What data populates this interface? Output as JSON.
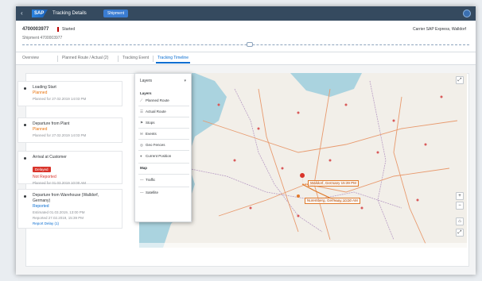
{
  "shell": {
    "back_icon": "back-arrow-icon",
    "logo_text": "SAP",
    "app_title": "Tracking Details",
    "system_badge": "Shipment"
  },
  "header": {
    "object_title": "4700003977",
    "status": "Started",
    "subtitle": "Shipment 4700003977",
    "right_info": "Carrier SAP Express, Walldorf"
  },
  "tabs": [
    {
      "label": "Overview"
    },
    {
      "label": "Planned Route / Actual (2)"
    },
    {
      "label": "Tracking Event"
    },
    {
      "label": "Tracking Timeline"
    }
  ],
  "timeline": [
    {
      "title": "Loading Start",
      "state": "Planned",
      "state_color": "#e9730c",
      "meta": "Planned for 27.02.2019 14:03 PM"
    },
    {
      "title": "Departure from Plant",
      "state": "Planned",
      "state_color": "#e9730c",
      "meta": "Planned for 27.02.2019 14:03 PM"
    },
    {
      "title": "Arrival at Customer",
      "badge": "Delayed",
      "state": "Not Reported",
      "state_color": "#d9342b",
      "meta": "Planned for 01.03.2019 10:00 AM"
    },
    {
      "title": "Departure from Warehouse (Walldorf, Germany)",
      "state": "Reported",
      "state_color": "#0a6ed1",
      "meta": "Estimated 01.03.2019, 13:00 PM",
      "meta2": "Reported 27.02.2019, 15:39 PM",
      "link": "Report Delay (1)"
    }
  ],
  "menu": {
    "header": "Layers",
    "section1": "Layers",
    "items1": [
      {
        "icon": "route-icon",
        "glyph": "⟋",
        "label": "Planned Route"
      },
      {
        "icon": "actual-route-icon",
        "glyph": "☰",
        "label": "Actual Route"
      },
      {
        "icon": "stops-icon",
        "glyph": "⚑",
        "label": "Stops"
      },
      {
        "icon": "events-icon",
        "glyph": "✉",
        "label": "Events"
      },
      {
        "icon": "geofence-icon",
        "glyph": "◎",
        "label": "Geo Fences"
      },
      {
        "icon": "vehicle-icon",
        "glyph": "●",
        "label": "Current Position"
      }
    ],
    "section2": "Map",
    "items2": [
      {
        "icon": "traffic-icon",
        "glyph": "―",
        "label": "Traffic"
      },
      {
        "icon": "satellite-icon",
        "glyph": "―",
        "label": "Satellite"
      }
    ]
  },
  "map": {
    "labels": [
      {
        "text": "Walldorf, Germany 15:39 PM",
        "kind": "event"
      },
      {
        "text": "Nuremberg, Germany 10:00 AM",
        "kind": "stop"
      }
    ],
    "controls": [
      "+",
      "−",
      "⌂",
      "⤢"
    ]
  },
  "colors": {
    "shell": "#354a5f",
    "accent": "#0a6ed1",
    "error": "#d9342b",
    "warning": "#e9730c",
    "water": "#aad3df",
    "land": "#f2efe9"
  }
}
